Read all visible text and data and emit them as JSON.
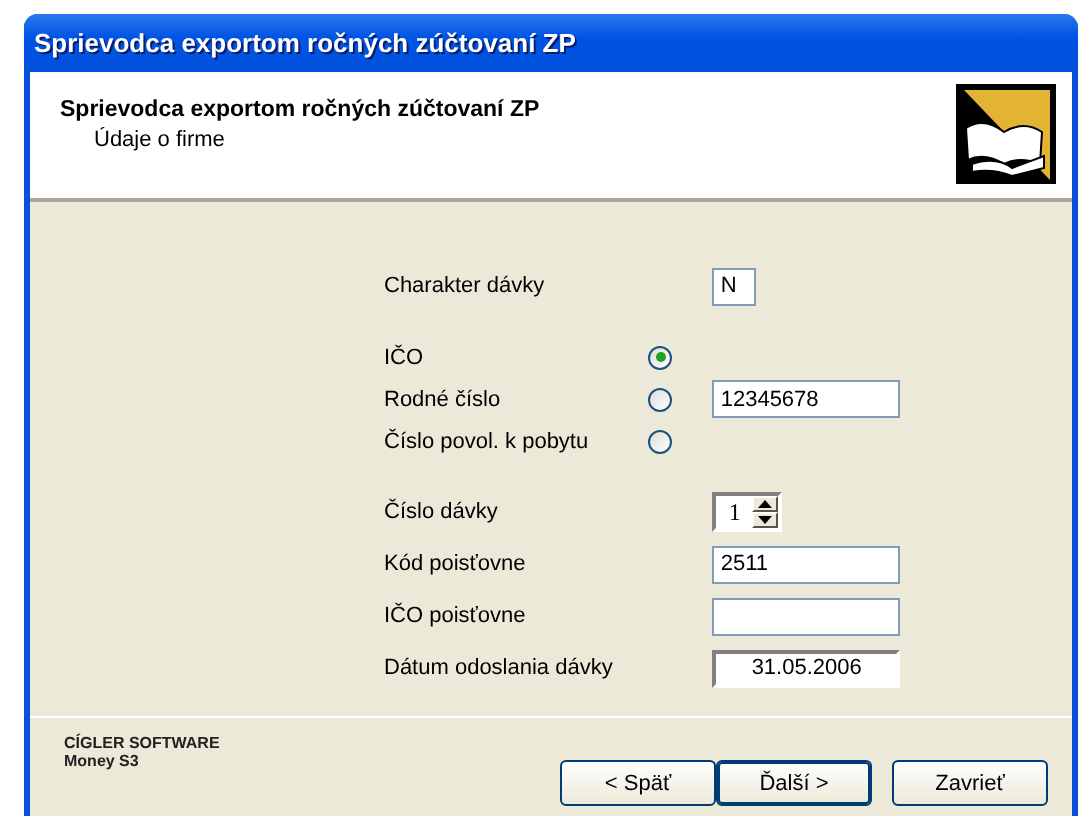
{
  "window": {
    "title": "Sprievodca exportom ročných zúčtovaní ZP"
  },
  "header": {
    "title": "Sprievodca exportom ročných zúčtovaní ZP",
    "subtitle": "Údaje o firme"
  },
  "groups": [
    [
      {
        "label": "Charakter dávky",
        "kind": "char",
        "value": "N"
      }
    ],
    [
      {
        "label": "IČO",
        "kind": "radio",
        "selected": true
      },
      {
        "label": "Rodné číslo",
        "kind": "radio",
        "selected": false,
        "value": "12345678"
      },
      {
        "label": "Číslo povol. k pobytu",
        "kind": "radio",
        "selected": false
      }
    ],
    [
      {
        "label": "Číslo dávky",
        "kind": "spinner",
        "value": "1"
      },
      {
        "label": "Kód poisťovne",
        "kind": "text",
        "value": "2511"
      },
      {
        "label": "IČO poisťovne",
        "kind": "text"
      },
      {
        "label": "Dátum odoslania dávky",
        "kind": "date",
        "value": "31.05.2006"
      }
    ]
  ],
  "footer": {
    "company": "CÍGLER SOFTWARE",
    "product": "Money S3"
  },
  "buttons": [
    {
      "label": "< Späť",
      "default": false
    },
    {
      "label": "Ďalší >",
      "default": true
    },
    {
      "label": "Zavrieť",
      "default": false
    }
  ]
}
